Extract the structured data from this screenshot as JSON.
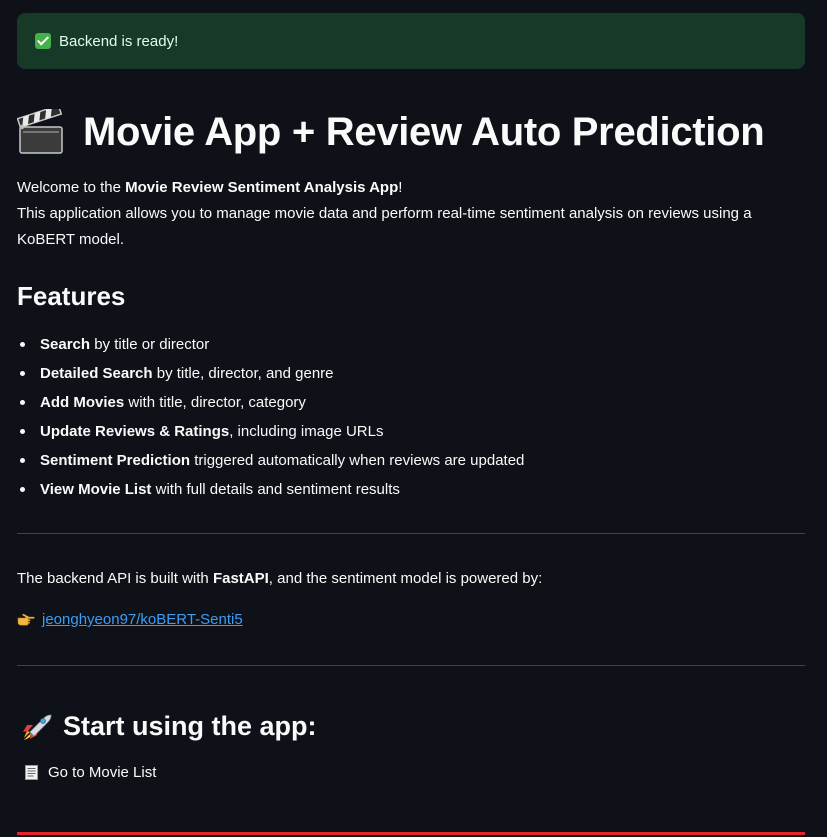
{
  "alert": {
    "text": "Backend is ready!"
  },
  "title": {
    "text": "Movie App + Review Auto Prediction"
  },
  "intro": {
    "welcome_prefix": "Welcome to the ",
    "app_name": "Movie Review Sentiment Analysis App",
    "welcome_suffix": "!",
    "description": "This application allows you to manage movie data and perform real-time sentiment analysis on reviews using a KoBERT model."
  },
  "features": {
    "heading": "Features",
    "items": [
      {
        "bold": "Search",
        "rest": " by title or director"
      },
      {
        "bold": "Detailed Search",
        "rest": " by title, director, and genre"
      },
      {
        "bold": "Add Movies",
        "rest": " with title, director, category"
      },
      {
        "bold": "Update Reviews & Ratings",
        "rest": ", including image URLs"
      },
      {
        "bold": "Sentiment Prediction",
        "rest": " triggered automatically when reviews are updated"
      },
      {
        "bold": "View Movie List",
        "rest": " with full details and sentiment results"
      }
    ]
  },
  "backend": {
    "prefix": "The backend API is built with ",
    "framework": "FastAPI",
    "suffix": ", and the sentiment model is powered by:",
    "model_link": "jeonghyeon97/koBERT-Senti5"
  },
  "start": {
    "heading": "Start using the app:",
    "page_link": "Go to Movie List"
  },
  "colors": {
    "background": "#0e1117",
    "success_bg": "#173928",
    "link": "#3d9df3",
    "accent_line": "#e5232d"
  },
  "icons": {
    "alert": "check-mark-icon",
    "title": "clapper-board-icon",
    "link": "pointing-hand-icon",
    "start": "rocket-icon",
    "page_link": "document-icon"
  }
}
